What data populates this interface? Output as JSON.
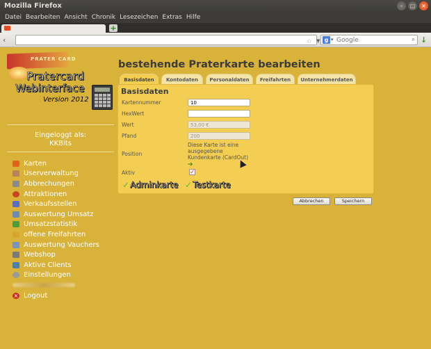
{
  "window": {
    "title": "Mozilla Firefox"
  },
  "menu": [
    "Datei",
    "Bearbeiten",
    "Ansicht",
    "Chronik",
    "Lesezeichen",
    "Extras",
    "Hilfe"
  ],
  "search": {
    "placeholder": "Google"
  },
  "logo": {
    "card": "PRATER CARD",
    "line1": "Pratercard",
    "line2": "Webinterface",
    "line3": "Version 2012"
  },
  "login": {
    "label": "Eingeloggt als:",
    "user": "KKBits"
  },
  "nav": [
    {
      "label": "Karten",
      "icon": "cards-icon",
      "color": "#e0641c"
    },
    {
      "label": "Userverwaltung",
      "icon": "user-icon",
      "color": "#b9845c"
    },
    {
      "label": "Abbrechungen",
      "icon": "document-icon",
      "color": "#8a8a8a"
    },
    {
      "label": "Attraktionen",
      "icon": "attraction-icon",
      "color": "#c8461f"
    },
    {
      "label": "Verkaufsstellen",
      "icon": "shop-icon",
      "color": "#5a6ec0"
    },
    {
      "label": "Auswertung Umsatz",
      "icon": "report-icon",
      "color": "#6b8bb0"
    },
    {
      "label": "Umsatzstatistik",
      "icon": "chart-icon",
      "color": "#4f9a3a"
    },
    {
      "label": "offene Freifahrten",
      "icon": "ticket-icon",
      "color": "#d9a52a"
    },
    {
      "label": "Auswertung Vauchers",
      "icon": "voucher-icon",
      "color": "#7a93b8"
    },
    {
      "label": "Webshop",
      "icon": "cart-icon",
      "color": "#7a7a7a"
    },
    {
      "label": "Aktive Clients",
      "icon": "clients-icon",
      "color": "#4f7fa8"
    },
    {
      "label": "Einstellungen",
      "icon": "settings-icon",
      "color": "#9a9a9a"
    },
    {
      "label": "",
      "icon": "blurred-icon",
      "color": "#d9b23a"
    },
    {
      "label": "Logout",
      "icon": "logout-icon",
      "color": "#c9301f"
    }
  ],
  "main": {
    "heading": "bestehende Praterkarte bearbeiten",
    "tabs": [
      "Basisdaten",
      "Kontodaten",
      "Personaldaten",
      "Freifahrten",
      "Unternehmerdaten"
    ],
    "active_tab": "Basisdaten",
    "panel_title": "Basisdaten",
    "fields": {
      "kartennummer": {
        "label": "Kartennummer",
        "value": "10"
      },
      "hexwert": {
        "label": "HexWert",
        "value": ""
      },
      "wert": {
        "label": "Wert",
        "value": "53,00 €"
      },
      "pfand": {
        "label": "Pfand",
        "value": "200"
      },
      "position": {
        "label": "Position",
        "text": "Diese Karte ist eine ausgegebene Kundenkarte (CardOut)"
      },
      "aktiv": {
        "label": "Aktiv",
        "checked": true
      }
    },
    "adminkarte": "Adminkarte",
    "testkarte": "Testkarte",
    "buttons": {
      "cancel": "Abbrechen",
      "save": "Speichern"
    }
  }
}
